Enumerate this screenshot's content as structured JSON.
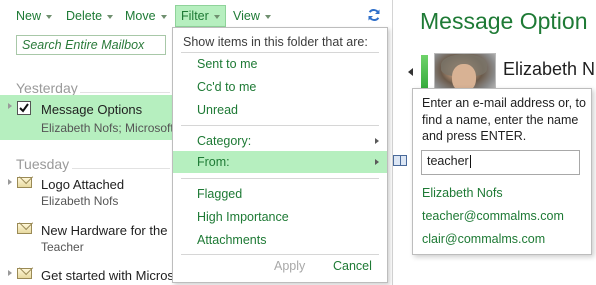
{
  "toolbar": {
    "new_label": "New",
    "delete_label": "Delete",
    "move_label": "Move",
    "filter_label": "Filter",
    "view_label": "View"
  },
  "search": {
    "placeholder": "Search Entire Mailbox"
  },
  "message_list": {
    "groups": [
      {
        "header": "Yesterday",
        "messages": [
          {
            "subject": "Message Options",
            "from": "Elizabeth Nofs; Microsoft"
          }
        ]
      },
      {
        "header": "Tuesday",
        "messages": [
          {
            "subject": "Logo Attached",
            "from": "Elizabeth Nofs"
          },
          {
            "subject": "New Hardware for the",
            "from": "Teacher"
          },
          {
            "subject": "Get started with Micros",
            "from": ""
          }
        ]
      }
    ]
  },
  "reading_pane": {
    "title": "Message Option",
    "sender": "Elizabeth N"
  },
  "filter_menu": {
    "heading": "Show items in this folder that are:",
    "items": [
      "Sent to me",
      "Cc'd to me",
      "Unread",
      "Category:",
      "From:",
      "Flagged",
      "High Importance",
      "Attachments"
    ],
    "apply_label": "Apply",
    "cancel_label": "Cancel"
  },
  "from_submenu": {
    "instructions": "Enter an e-mail address or, to find a name, enter the name and press ENTER.",
    "input_value": "teacher",
    "results": [
      "Elizabeth Nofs",
      "teacher@commalms.com",
      "clair@commalms.com"
    ]
  },
  "colors": {
    "accent": "#1e7a35",
    "selection": "#b6efbf",
    "refresh_icon": "#2f6fc9"
  },
  "icons": [
    "refresh-icon",
    "envelope-icon",
    "checkbox-icon",
    "address-book-icon",
    "submenu-arrow-icon"
  ]
}
